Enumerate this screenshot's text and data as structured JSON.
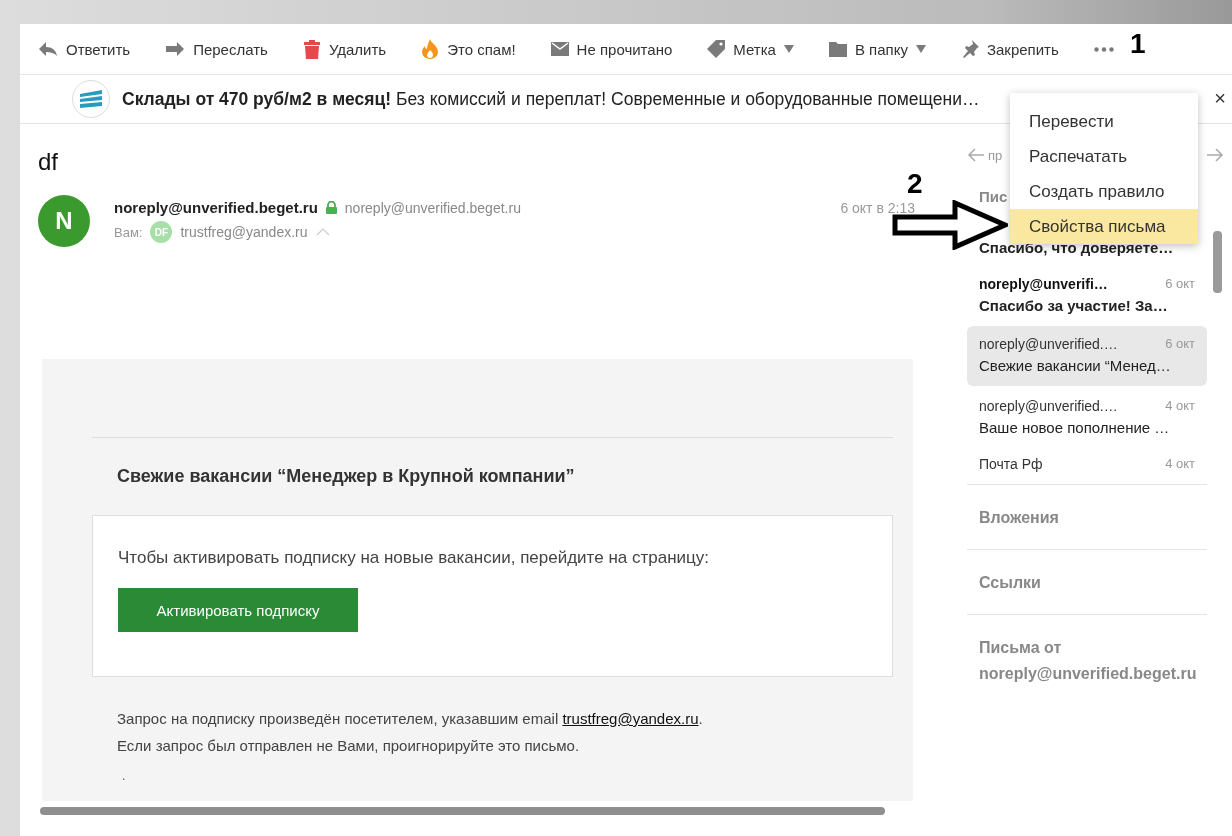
{
  "toolbar": [
    {
      "label": "Ответить",
      "has_menu": false
    },
    {
      "label": "Переслать",
      "has_menu": false
    },
    {
      "label": "Удалить",
      "has_menu": false
    },
    {
      "label": "Это спам!",
      "has_menu": false
    },
    {
      "label": "Не прочитано",
      "has_menu": false
    },
    {
      "label": "Метка",
      "has_menu": true
    },
    {
      "label": "В папку",
      "has_menu": true
    },
    {
      "label": "Закрепить",
      "has_menu": false
    }
  ],
  "banner": {
    "text": "**Склады от 470 руб/м2 в месяц!** Без комиссий и переплат! Современные и оборудованные помещени…",
    "close": "×"
  },
  "more_menu": [
    {
      "label": "Перевести",
      "selected": false
    },
    {
      "label": "Распечатать",
      "selected": false
    },
    {
      "label": "Создать правило",
      "selected": false
    },
    {
      "label": "Свойства письма",
      "selected": true
    }
  ],
  "annotations": [
    "1",
    "2"
  ],
  "message": {
    "subject": "df",
    "avatar": "N",
    "sender": "noreply@unverified.beget.ru",
    "sender_address": "noreply@unverified.beget.ru",
    "date": "6 окт в 2:13",
    "to_label": "Вам:",
    "recipient_avatar": "DF",
    "recipient": "trustfreg@yandex.ru"
  },
  "body": {
    "heading": "Свежие вакансии “Менеджер в Крупной компании”",
    "prompt": "Чтобы активировать подписку на новые вакансии, перейдите на страницу:",
    "button": "Активировать подписку",
    "footer_before": "Запрос на подписку произведён посетителем, указавшим email ",
    "footer_link": "trustfreg@yandex.ru",
    "footer_after": ".",
    "footer_line2": "Если запрос был отправлен не Вами, проигнорируйте это письмо.",
    "tail": "."
  },
  "sidebar": {
    "nav_label": "пр",
    "thread_heading": "Пис",
    "threads": [
      {
        "subject": "Спасибо, что доверяете…",
        "unread": true,
        "selected": false
      },
      {
        "sender": "noreply@unverifi…",
        "date": "6 окт",
        "subject": "Спасибо за участие! За…",
        "unread": true,
        "selected": false
      },
      {
        "sender": "noreply@unverified.…",
        "date": "6 окт",
        "subject": "Свежие вакансии “Менед…",
        "unread": false,
        "selected": true
      },
      {
        "sender": "noreply@unverified.…",
        "date": "4 окт",
        "subject": "Ваше новое пополнение …",
        "unread": false,
        "selected": false
      },
      {
        "sender": "Почта Рф",
        "date": "4 окт",
        "unread": false,
        "selected": false
      }
    ],
    "sections": [
      "Вложения",
      "Ссылки",
      "Письма от noreply@unverified.beget.ru"
    ]
  }
}
